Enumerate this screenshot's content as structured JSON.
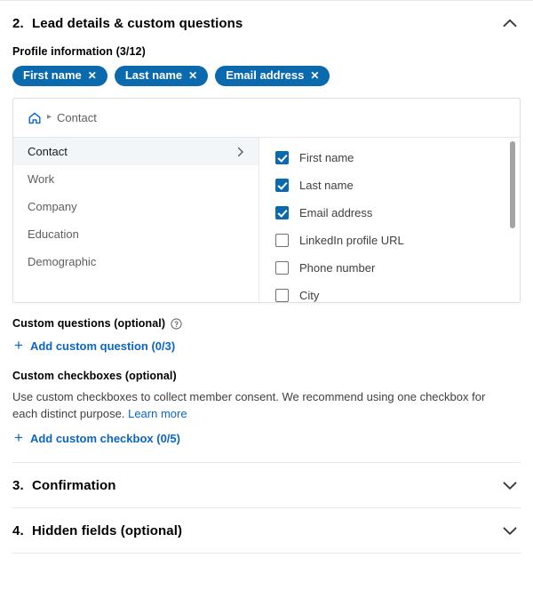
{
  "sections": [
    {
      "number": "2.",
      "title": "Lead details & custom questions",
      "toggle_icon": "chevron-up-icon",
      "expanded": true
    },
    {
      "number": "3.",
      "title": "Confirmation",
      "toggle_icon": "chevron-down-icon",
      "expanded": false
    },
    {
      "number": "4.",
      "title": "Hidden fields (optional)",
      "toggle_icon": "chevron-down-icon",
      "expanded": false
    }
  ],
  "profile_information": {
    "label": "Profile information (3/12)",
    "selected_count": 3,
    "max_count": 12,
    "chips": [
      {
        "label": "First name",
        "remove_icon": "close-x-icon"
      },
      {
        "label": "Last name",
        "remove_icon": "close-x-icon"
      },
      {
        "label": "Email address",
        "remove_icon": "close-x-icon"
      }
    ]
  },
  "picker_panel": {
    "breadcrumb": {
      "home_icon": "home-icon",
      "separator": "▸",
      "current": "Contact"
    },
    "categories": [
      {
        "label": "Contact",
        "selected": true,
        "chevron": "chevron-right-icon"
      },
      {
        "label": "Work",
        "selected": false
      },
      {
        "label": "Company",
        "selected": false
      },
      {
        "label": "Education",
        "selected": false
      },
      {
        "label": "Demographic",
        "selected": false
      }
    ],
    "fields": [
      {
        "label": "First name",
        "checked": true
      },
      {
        "label": "Last name",
        "checked": true
      },
      {
        "label": "Email address",
        "checked": true
      },
      {
        "label": "LinkedIn profile URL",
        "checked": false
      },
      {
        "label": "Phone number",
        "checked": false
      },
      {
        "label": "City",
        "checked": false
      }
    ]
  },
  "custom_questions": {
    "heading": "Custom questions (optional)",
    "help_icon": "help-circle-icon",
    "add_label": "Add custom question (0/3)",
    "add_icon": "plus-icon"
  },
  "custom_checkboxes": {
    "heading": "Custom checkboxes (optional)",
    "description": "Use custom checkboxes to collect member consent. We recommend using one checkbox for each distinct purpose.",
    "learn_more": "Learn more",
    "add_label": "Add custom checkbox (0/5)",
    "add_icon": "plus-icon"
  },
  "colors": {
    "brand_blue": "#0a66c2",
    "chip_blue": "#0b69ae",
    "divider": "#e8e8e8",
    "selected_row": "#f3f6f8",
    "text_primary": "#000000",
    "text_secondary": "#5e5e5e"
  }
}
